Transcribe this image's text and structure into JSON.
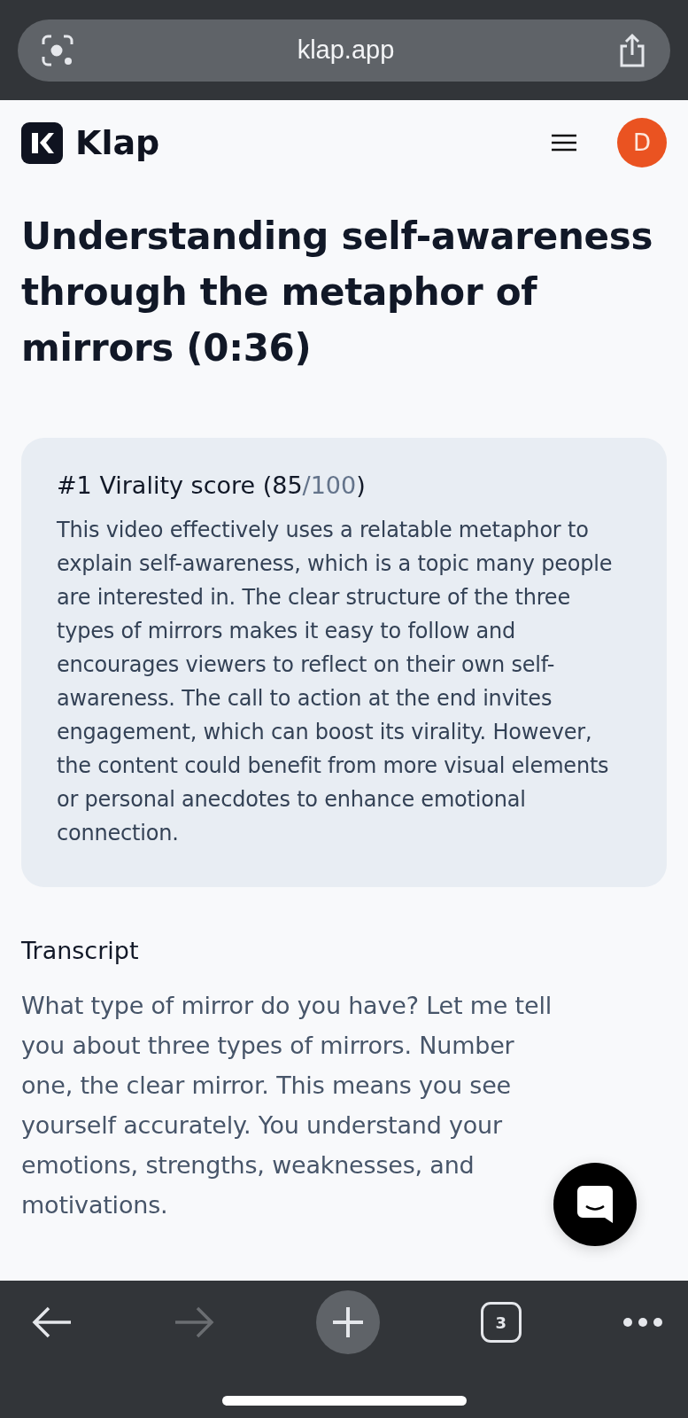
{
  "browser": {
    "url": "klap.app",
    "tab_count": "3"
  },
  "header": {
    "logo_text": "Klap",
    "avatar": "D"
  },
  "title": "Understanding self-awareness through the metaphor of mirrors (0:36)",
  "score_card": {
    "heading": "#1 Virality score (",
    "score": "85",
    "max": "/100",
    "heading_end": ")",
    "body": "This video effectively uses a relatable metaphor to explain self-awareness, which is a topic many people are interested in. The clear structure of the three types of mirrors makes it easy to follow and encourages viewers to reflect on their own self-awareness. The call to action at the end invites engagement, which can boost its virality. However, the content could benefit from more visual elements or personal anecdotes to enhance emotional connection."
  },
  "transcript": {
    "heading": "Transcript",
    "text": "What type of mirror do you have? Let me tell you about three types of mirrors. Number one, the clear mirror. This means you see yourself accurately. You understand your emotions, strengths, weaknesses, and motivations."
  },
  "toolbar": {
    "forward_disabled": true
  }
}
